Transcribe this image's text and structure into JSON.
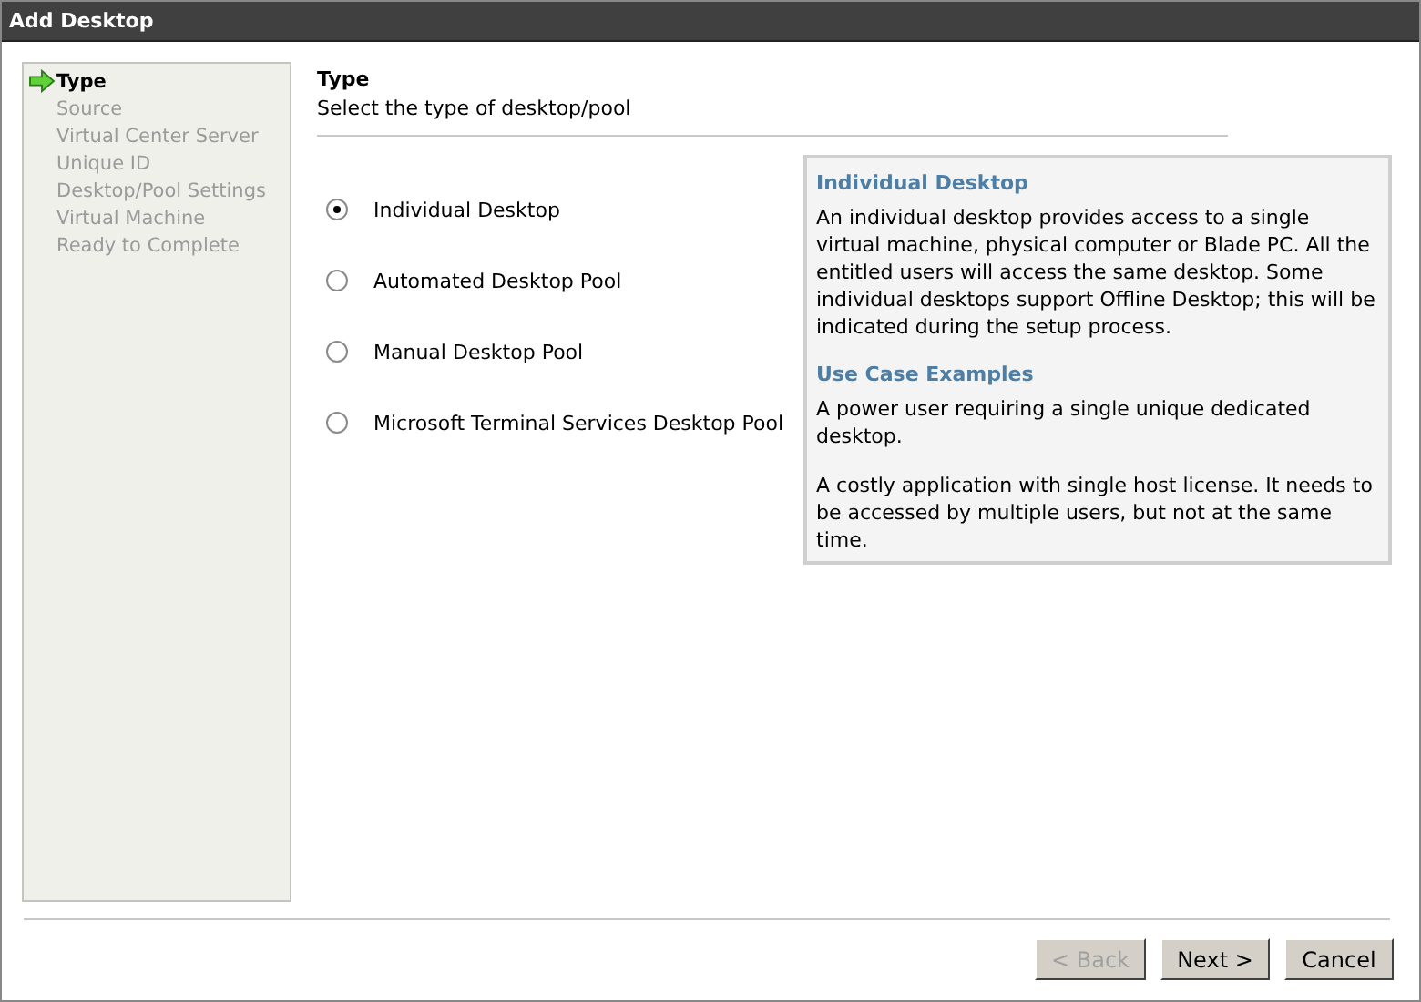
{
  "window": {
    "title": "Add Desktop"
  },
  "steps": [
    {
      "label": "Type",
      "selected": true
    },
    {
      "label": "Source",
      "selected": false
    },
    {
      "label": "Virtual Center Server",
      "selected": false
    },
    {
      "label": "Unique ID",
      "selected": false
    },
    {
      "label": "Desktop/Pool Settings",
      "selected": false
    },
    {
      "label": "Virtual Machine",
      "selected": false
    },
    {
      "label": "Ready to Complete",
      "selected": false
    }
  ],
  "page": {
    "title": "Type",
    "subtitle": "Select the type of desktop/pool"
  },
  "options": [
    {
      "label": "Individual Desktop",
      "selected": true
    },
    {
      "label": "Automated Desktop Pool",
      "selected": false
    },
    {
      "label": "Manual Desktop Pool",
      "selected": false
    },
    {
      "label": "Microsoft Terminal Services Desktop Pool",
      "selected": false
    }
  ],
  "info": {
    "sections": [
      {
        "heading": "Individual Desktop",
        "paragraphs": [
          "An individual desktop provides access to a single virtual machine, physical computer or Blade PC. All the entitled users will access the same desktop. Some individual desktops support Offline Desktop; this will be indicated during the setup process."
        ]
      },
      {
        "heading": "Use Case Examples",
        "paragraphs": [
          "A power user requiring a single unique dedicated desktop.",
          "A costly application with single host license. It needs to be accessed by multiple users, but not at the same time."
        ]
      }
    ]
  },
  "buttons": [
    {
      "label": "< Back",
      "disabled": true
    },
    {
      "label": "Next >",
      "disabled": false
    },
    {
      "label": "Cancel",
      "disabled": false
    }
  ]
}
